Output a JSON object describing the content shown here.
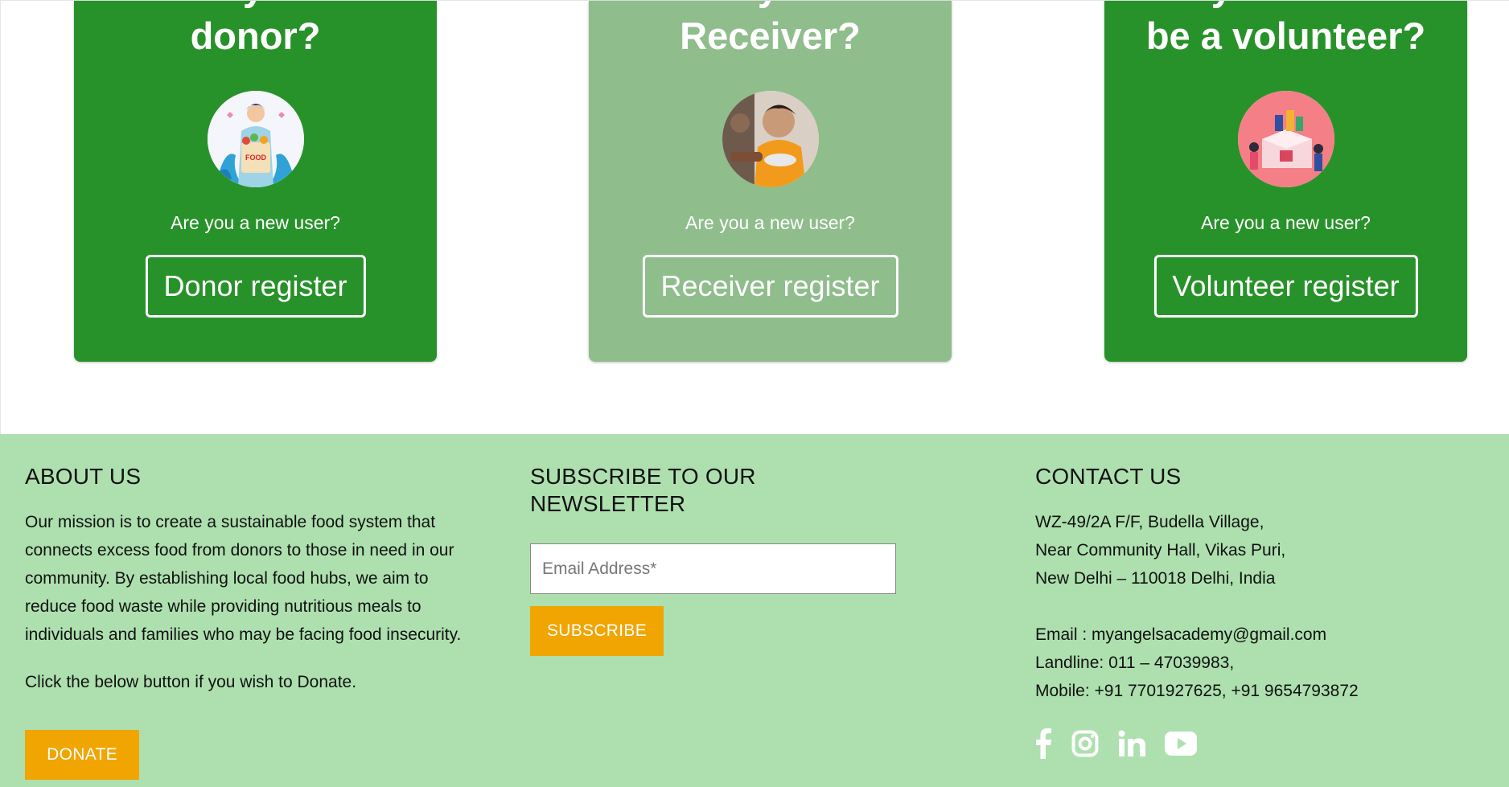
{
  "cards": [
    {
      "title_line1": "Are you a",
      "title_line2": "donor?",
      "question": "Are you a new user?",
      "button": "Donor register"
    },
    {
      "title_line1": "Are you a",
      "title_line2": "Receiver?",
      "question": "Are you a new user?",
      "button": "Receiver register"
    },
    {
      "title_line1": "Do you want to",
      "title_line2": "be a volunteer?",
      "question": "Are you a new user?",
      "button": "Volunteer register"
    }
  ],
  "donor_badge": "FOOD",
  "footer": {
    "about": {
      "heading": "ABOUT US",
      "text": "Our mission is to create a sustainable food system that connects excess food from donors to those in need in our community. By establishing local food hubs, we aim to reduce food waste while providing nutritious meals to individuals and families who may be facing food insecurity.",
      "note": "Click the below button if you wish to Donate.",
      "donate_label": "DONATE"
    },
    "newsletter": {
      "heading": "SUBSCRIBE TO OUR NEWSLETTER",
      "email_placeholder": "Email Address*",
      "subscribe_label": "SUBSCRIBE"
    },
    "contact": {
      "heading": "CONTACT US",
      "address": [
        "WZ-49/2A F/F, Budella Village,",
        "Near Community Hall, Vikas Puri,",
        "New Delhi – 110018 Delhi, India"
      ],
      "email": "Email : myangelsacademy@gmail.com",
      "landline": "Landline: 011 – 47039983,",
      "mobile": "Mobile: +91 7701927625, +91 9654793872"
    },
    "socials": [
      "facebook-icon",
      "instagram-icon",
      "linkedin-icon",
      "youtube-icon"
    ]
  },
  "colors": {
    "card_green": "#28922a",
    "card_pale": "#8fbd8c",
    "footer_bg": "#ade0ae",
    "accent_orange": "#f0a500"
  }
}
